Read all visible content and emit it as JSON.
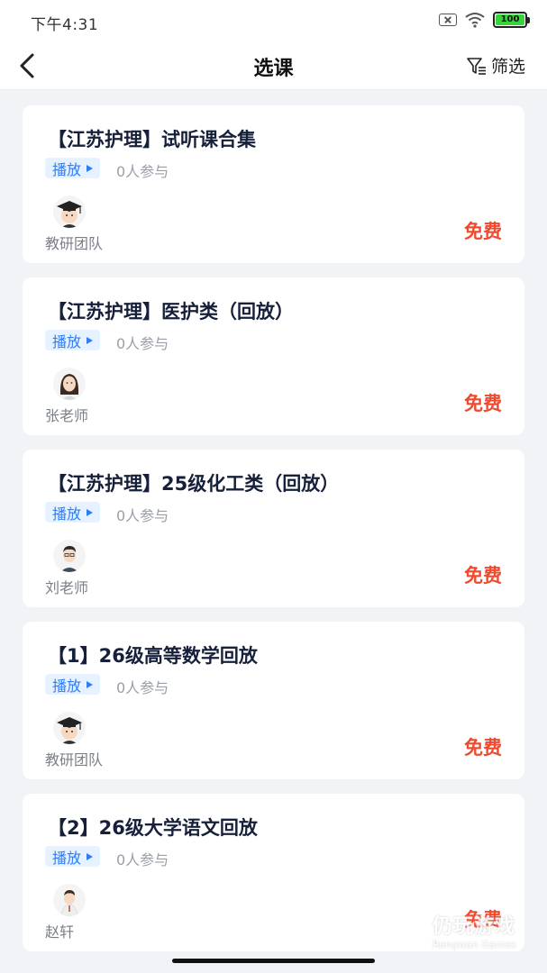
{
  "status_bar": {
    "time": "下午4:31",
    "battery": "100"
  },
  "nav": {
    "title": "选课",
    "filter_label": "筛选"
  },
  "courses": [
    {
      "title": "【江苏护理】试听课合集",
      "tag": "播放",
      "participants": "0人参与",
      "teacher": "教研团队",
      "price": "免费",
      "avatar": "graduate-avatar"
    },
    {
      "title": "【江苏护理】医护类（回放）",
      "tag": "播放",
      "participants": "0人参与",
      "teacher": "张老师",
      "price": "免费",
      "avatar": "female-teacher-avatar"
    },
    {
      "title": "【江苏护理】25级化工类（回放）",
      "tag": "播放",
      "participants": "0人参与",
      "teacher": "刘老师",
      "price": "免费",
      "avatar": "male-teacher-avatar"
    },
    {
      "title": "【1】26级高等数学回放",
      "tag": "播放",
      "participants": "0人参与",
      "teacher": "教研团队",
      "price": "免费",
      "avatar": "graduate-avatar"
    },
    {
      "title": "【2】26级大学语文回放",
      "tag": "播放",
      "participants": "0人参与",
      "teacher": "赵轩",
      "price": "免费",
      "avatar": "teacher-avatar"
    }
  ],
  "watermark": {
    "cn": "仍玩游戏",
    "en": "Rengwan Games"
  },
  "colors": {
    "accent_blue": "#2f7cf6",
    "price_red": "#f0492d",
    "background": "#f2f3f7"
  }
}
